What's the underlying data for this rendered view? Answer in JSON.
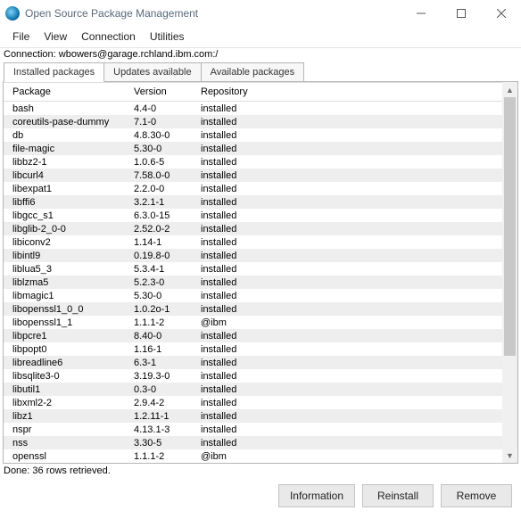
{
  "window": {
    "title": "Open Source Package Management"
  },
  "menu": {
    "file": "File",
    "view": "View",
    "connection": "Connection",
    "utilities": "Utilities"
  },
  "connection_line": "Connection: wbowers@garage.rchland.ibm.com:/",
  "tabs": {
    "installed": "Installed packages",
    "updates": "Updates available",
    "available": "Available packages"
  },
  "columns": {
    "package": "Package",
    "version": "Version",
    "repository": "Repository"
  },
  "rows": [
    {
      "pkg": "bash",
      "ver": "4.4-0",
      "repo": "installed"
    },
    {
      "pkg": "coreutils-pase-dummy",
      "ver": "7.1-0",
      "repo": "installed"
    },
    {
      "pkg": "db",
      "ver": "4.8.30-0",
      "repo": "installed"
    },
    {
      "pkg": "file-magic",
      "ver": "5.30-0",
      "repo": "installed"
    },
    {
      "pkg": "libbz2-1",
      "ver": "1.0.6-5",
      "repo": "installed"
    },
    {
      "pkg": "libcurl4",
      "ver": "7.58.0-0",
      "repo": "installed"
    },
    {
      "pkg": "libexpat1",
      "ver": "2.2.0-0",
      "repo": "installed"
    },
    {
      "pkg": "libffi6",
      "ver": "3.2.1-1",
      "repo": "installed"
    },
    {
      "pkg": "libgcc_s1",
      "ver": "6.3.0-15",
      "repo": "installed"
    },
    {
      "pkg": "libglib-2_0-0",
      "ver": "2.52.0-2",
      "repo": "installed"
    },
    {
      "pkg": "libiconv2",
      "ver": "1.14-1",
      "repo": "installed"
    },
    {
      "pkg": "libintl9",
      "ver": "0.19.8-0",
      "repo": "installed"
    },
    {
      "pkg": "liblua5_3",
      "ver": "5.3.4-1",
      "repo": "installed"
    },
    {
      "pkg": "liblzma5",
      "ver": "5.2.3-0",
      "repo": "installed"
    },
    {
      "pkg": "libmagic1",
      "ver": "5.30-0",
      "repo": "installed"
    },
    {
      "pkg": "libopenssl1_0_0",
      "ver": "1.0.2o-1",
      "repo": "installed"
    },
    {
      "pkg": "libopenssl1_1",
      "ver": "1.1.1-2",
      "repo": "@ibm"
    },
    {
      "pkg": "libpcre1",
      "ver": "8.40-0",
      "repo": "installed"
    },
    {
      "pkg": "libpopt0",
      "ver": "1.16-1",
      "repo": "installed"
    },
    {
      "pkg": "libreadline6",
      "ver": "6.3-1",
      "repo": "installed"
    },
    {
      "pkg": "libsqlite3-0",
      "ver": "3.19.3-0",
      "repo": "installed"
    },
    {
      "pkg": "libutil1",
      "ver": "0.3-0",
      "repo": "installed"
    },
    {
      "pkg": "libxml2-2",
      "ver": "2.9.4-2",
      "repo": "installed"
    },
    {
      "pkg": "libz1",
      "ver": "1.2.11-1",
      "repo": "installed"
    },
    {
      "pkg": "nspr",
      "ver": "4.13.1-3",
      "repo": "installed"
    },
    {
      "pkg": "nss",
      "ver": "3.30-5",
      "repo": "installed"
    },
    {
      "pkg": "openssl",
      "ver": "1.1.1-2",
      "repo": "@ibm"
    }
  ],
  "status_done": "Done: 36 rows retrieved.",
  "buttons": {
    "info": "Information",
    "reinstall": "Reinstall",
    "remove": "Remove"
  }
}
